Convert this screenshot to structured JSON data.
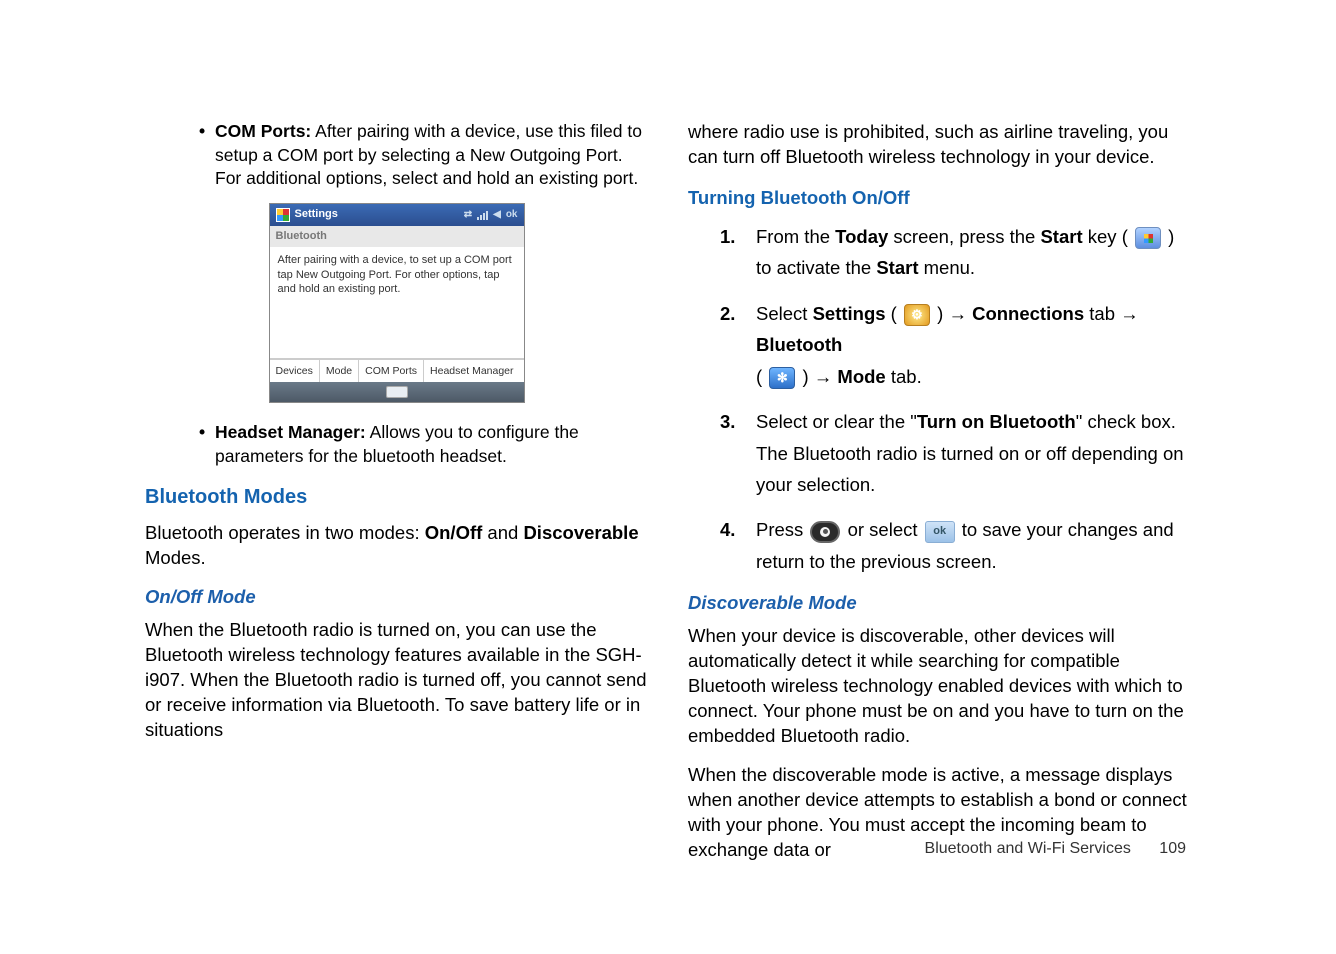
{
  "left": {
    "bullet1_label": "COM Ports:",
    "bullet1_text": " After pairing with a device, use this filed to setup a COM port by selecting a New Outgoing Port. For additional options, select and hold an existing port.",
    "screenshot": {
      "title": "Settings",
      "ok": "ok",
      "sub": "Bluetooth",
      "body": "After pairing with a device, to set up a COM port tap New Outgoing Port. For other options, tap and hold an existing port.",
      "tabs": [
        "Devices",
        "Mode",
        "COM Ports",
        "Headset Manager"
      ]
    },
    "bullet2_label": "Headset Manager:",
    "bullet2_text": " Allows you to configure the parameters for the bluetooth headset.",
    "section_head": "Bluetooth Modes",
    "modes_para_pre": "Bluetooth operates in two modes: ",
    "modes_para_b1": "On/Off",
    "modes_para_mid": " and ",
    "modes_para_b2": "Discoverable",
    "modes_para_post": " Modes.",
    "onoff_head": "On/Off Mode",
    "onoff_para": "When the Bluetooth radio is turned on, you can use the Bluetooth wireless technology features available in the SGH-i907. When the Bluetooth radio is turned off, you cannot send or receive information via Bluetooth. To save battery life or in situations"
  },
  "right": {
    "cont_para": "where radio use is prohibited, such as airline traveling, you can turn off Bluetooth wireless technology in your device.",
    "turning_head": "Turning Bluetooth On/Off",
    "steps": {
      "s1_num": "1.",
      "s1_pre": "From the ",
      "s1_b1": "Today",
      "s1_mid1": " screen, press the ",
      "s1_b2": "Start",
      "s1_mid2": " key ( ",
      "s1_mid3": " ) to activate the ",
      "s1_b3": "Start",
      "s1_post": " menu.",
      "s2_num": "2.",
      "s2_pre": "Select ",
      "s2_b1": "Settings",
      "s2_p1": " ( ",
      "s2_p1b": " ) ",
      "s2_arrow": " → ",
      "s2_b2": "Connections",
      "s2_t1": " tab ",
      "s2_b3": "Bluetooth",
      "s2_line2a": "( ",
      "s2_line2b": " ) ",
      "s2_b4": "Mode",
      "s2_line2c": " tab.",
      "s3_num": "3.",
      "s3_pre": "Select or clear the \"",
      "s3_b1": "Turn on Bluetooth",
      "s3_post": "\" check box. The Bluetooth radio is turned on or off depending on your selection.",
      "s4_num": "4.",
      "s4_pre": "Press ",
      "s4_mid": " or select ",
      "s4_post": " to save your changes and return to the previous screen."
    },
    "disc_head": "Discoverable Mode",
    "disc_p1": "When your device is discoverable, other devices will automatically detect it while searching for compatible Bluetooth wireless technology enabled devices with which to connect. Your phone must be on and you have to turn on the embedded Bluetooth radio.",
    "disc_p2": "When the discoverable mode is active, a message displays when another device attempts to establish a bond or connect with your phone. You must accept the incoming beam to exchange data or"
  },
  "footer": {
    "section": "Bluetooth and Wi-Fi Services",
    "page": "109"
  },
  "icons": {
    "ok_label": "ok",
    "bt_glyph": "✻"
  }
}
